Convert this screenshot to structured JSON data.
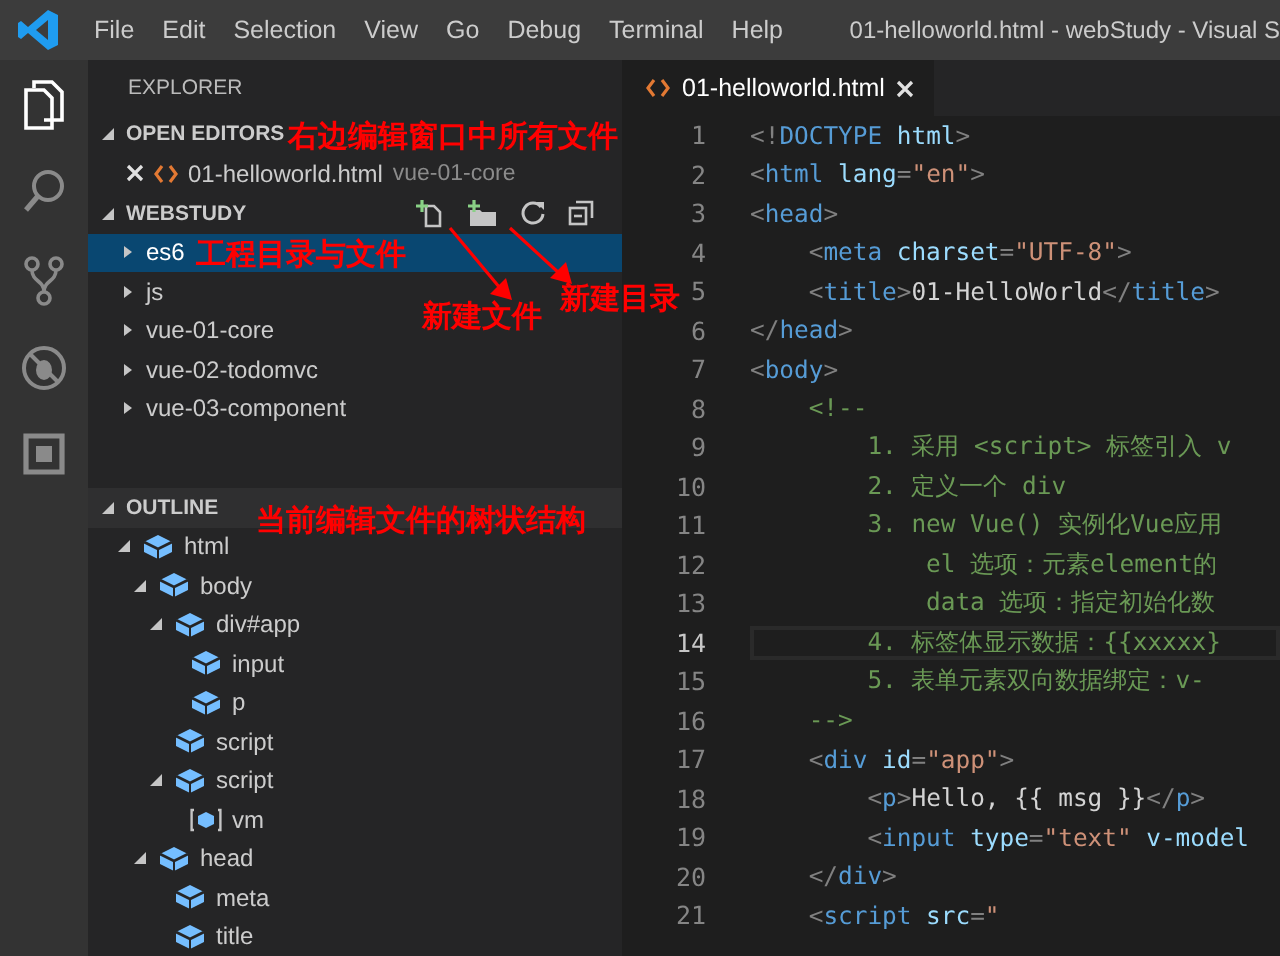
{
  "window": {
    "title": "01-helloworld.html - webStudy - Visual S"
  },
  "menu": [
    "File",
    "Edit",
    "Selection",
    "View",
    "Go",
    "Debug",
    "Terminal",
    "Help"
  ],
  "activity_bar": [
    {
      "kind": "files",
      "selected": true
    },
    {
      "kind": "search",
      "selected": false
    },
    {
      "kind": "scm",
      "selected": false
    },
    {
      "kind": "debug",
      "selected": false
    },
    {
      "kind": "extensions",
      "selected": false
    }
  ],
  "explorer": {
    "title": "EXPLORER",
    "open_editors": {
      "title": "OPEN EDITORS",
      "expanded": true,
      "files": [
        {
          "name": "01-helloworld.html",
          "folder": "vue-01-core"
        }
      ]
    },
    "workspace": {
      "title": "WEBSTUDY",
      "expanded": true,
      "items": [
        {
          "label": "es6",
          "selected": true,
          "expanded": false
        },
        {
          "label": "js",
          "selected": false,
          "expanded": false
        },
        {
          "label": "vue-01-core",
          "selected": false,
          "expanded": false
        },
        {
          "label": "vue-02-todomvc",
          "selected": false,
          "expanded": false
        },
        {
          "label": "vue-03-component",
          "selected": false,
          "expanded": false
        }
      ]
    },
    "outline": {
      "title": "OUTLINE",
      "expanded": true,
      "items": [
        {
          "label": "html",
          "kind": "element",
          "expanded": true,
          "children": [
            {
              "label": "body",
              "kind": "element",
              "expanded": true,
              "children": [
                {
                  "label": "div#app",
                  "kind": "element",
                  "expanded": true,
                  "children": [
                    {
                      "label": "input",
                      "kind": "element"
                    },
                    {
                      "label": "p",
                      "kind": "element"
                    }
                  ]
                },
                {
                  "label": "script",
                  "kind": "element"
                },
                {
                  "label": "script",
                  "kind": "element",
                  "expanded": true,
                  "children": [
                    {
                      "label": "vm",
                      "kind": "variable"
                    }
                  ]
                }
              ]
            },
            {
              "label": "head",
              "kind": "element",
              "expanded": true,
              "children": [
                {
                  "label": "meta",
                  "kind": "element"
                },
                {
                  "label": "title",
                  "kind": "element"
                }
              ]
            }
          ]
        }
      ]
    }
  },
  "editor": {
    "tabs": [
      {
        "label": "01-helloworld.html",
        "selected": true
      }
    ],
    "lines": [
      {
        "number": "1",
        "current": false,
        "tokens": [
          {
            "kind": "punct",
            "text": "<!"
          },
          {
            "kind": "tag",
            "text": "DOCTYPE"
          },
          {
            "kind": "attr",
            "text": " html"
          },
          {
            "kind": "punct",
            "text": ">"
          }
        ]
      },
      {
        "number": "2",
        "current": false,
        "tokens": [
          {
            "kind": "punct",
            "text": "<"
          },
          {
            "kind": "tag",
            "text": "html"
          },
          {
            "kind": "attr",
            "text": " lang"
          },
          {
            "kind": "punct",
            "text": "="
          },
          {
            "kind": "string",
            "text": "\"en\""
          },
          {
            "kind": "punct",
            "text": ">"
          }
        ]
      },
      {
        "number": "3",
        "current": false,
        "tokens": [
          {
            "kind": "punct",
            "text": "<"
          },
          {
            "kind": "tag",
            "text": "head"
          },
          {
            "kind": "punct",
            "text": ">"
          }
        ]
      },
      {
        "number": "4",
        "current": false,
        "tokens": [
          {
            "kind": "punct",
            "text": "    <"
          },
          {
            "kind": "tag",
            "text": "meta"
          },
          {
            "kind": "attr",
            "text": " charset"
          },
          {
            "kind": "punct",
            "text": "="
          },
          {
            "kind": "string",
            "text": "\"UTF-8\""
          },
          {
            "kind": "punct",
            "text": ">"
          }
        ]
      },
      {
        "number": "5",
        "current": false,
        "tokens": [
          {
            "kind": "punct",
            "text": "    <"
          },
          {
            "kind": "tag",
            "text": "title"
          },
          {
            "kind": "punct",
            "text": ">"
          },
          {
            "kind": "text",
            "text": "01-HelloWorld"
          },
          {
            "kind": "punct",
            "text": "</"
          },
          {
            "kind": "tag",
            "text": "title"
          },
          {
            "kind": "punct",
            "text": ">"
          }
        ]
      },
      {
        "number": "6",
        "current": false,
        "tokens": [
          {
            "kind": "punct",
            "text": "</"
          },
          {
            "kind": "tag",
            "text": "head"
          },
          {
            "kind": "punct",
            "text": ">"
          }
        ]
      },
      {
        "number": "7",
        "current": false,
        "tokens": [
          {
            "kind": "punct",
            "text": "<"
          },
          {
            "kind": "tag",
            "text": "body"
          },
          {
            "kind": "punct",
            "text": ">"
          }
        ]
      },
      {
        "number": "8",
        "current": false,
        "tokens": [
          {
            "kind": "comment",
            "text": "    <!--"
          }
        ]
      },
      {
        "number": "9",
        "current": false,
        "tokens": [
          {
            "kind": "comment",
            "text": "        1. 采用 <script> 标签引入 v"
          }
        ]
      },
      {
        "number": "10",
        "current": false,
        "tokens": [
          {
            "kind": "comment",
            "text": "        2. 定义一个 div"
          }
        ]
      },
      {
        "number": "11",
        "current": false,
        "tokens": [
          {
            "kind": "comment",
            "text": "        3. new Vue() 实例化Vue应用"
          }
        ]
      },
      {
        "number": "12",
        "current": false,
        "tokens": [
          {
            "kind": "comment",
            "text": "            el 选项：元素element的"
          }
        ]
      },
      {
        "number": "13",
        "current": false,
        "tokens": [
          {
            "kind": "comment",
            "text": "            data 选项：指定初始化数"
          }
        ]
      },
      {
        "number": "14",
        "current": true,
        "tokens": [
          {
            "kind": "comment",
            "text": "        4. 标签体显示数据：{{xxxxx}"
          }
        ]
      },
      {
        "number": "15",
        "current": false,
        "tokens": [
          {
            "kind": "comment",
            "text": "        5. 表单元素双向数据绑定：v-"
          }
        ]
      },
      {
        "number": "16",
        "current": false,
        "tokens": [
          {
            "kind": "comment",
            "text": "    -->"
          }
        ]
      },
      {
        "number": "17",
        "current": false,
        "tokens": [
          {
            "kind": "punct",
            "text": "    <"
          },
          {
            "kind": "tag",
            "text": "div"
          },
          {
            "kind": "attr",
            "text": " id"
          },
          {
            "kind": "punct",
            "text": "="
          },
          {
            "kind": "string",
            "text": "\"app\""
          },
          {
            "kind": "punct",
            "text": ">"
          }
        ]
      },
      {
        "number": "18",
        "current": false,
        "tokens": [
          {
            "kind": "punct",
            "text": "        <"
          },
          {
            "kind": "tag",
            "text": "p"
          },
          {
            "kind": "punct",
            "text": ">"
          },
          {
            "kind": "text",
            "text": "Hello, {{ msg }}"
          },
          {
            "kind": "punct",
            "text": "</"
          },
          {
            "kind": "tag",
            "text": "p"
          },
          {
            "kind": "punct",
            "text": ">"
          }
        ]
      },
      {
        "number": "19",
        "current": false,
        "tokens": [
          {
            "kind": "punct",
            "text": "        <"
          },
          {
            "kind": "tag",
            "text": "input"
          },
          {
            "kind": "attr",
            "text": " type"
          },
          {
            "kind": "punct",
            "text": "="
          },
          {
            "kind": "string",
            "text": "\"text\""
          },
          {
            "kind": "attr",
            "text": " v-model"
          }
        ]
      },
      {
        "number": "20",
        "current": false,
        "tokens": [
          {
            "kind": "punct",
            "text": "    </"
          },
          {
            "kind": "tag",
            "text": "div"
          },
          {
            "kind": "punct",
            "text": ">"
          }
        ]
      },
      {
        "number": "21",
        "current": false,
        "tokens": [
          {
            "kind": "punct",
            "text": "    <"
          },
          {
            "kind": "tag",
            "text": "script"
          },
          {
            "kind": "attr",
            "text": " src"
          },
          {
            "kind": "punct",
            "text": "="
          },
          {
            "kind": "string",
            "text": "\""
          }
        ]
      }
    ]
  },
  "annotations": [
    {
      "text": "右边编辑窗口中所有文件",
      "arrow": false
    },
    {
      "text": "工程目录与文件",
      "arrow": false
    },
    {
      "text": "新建文件",
      "arrow": true
    },
    {
      "text": "新建目录",
      "arrow": true
    },
    {
      "text": "当前编辑文件的树状结构",
      "arrow": false
    }
  ]
}
